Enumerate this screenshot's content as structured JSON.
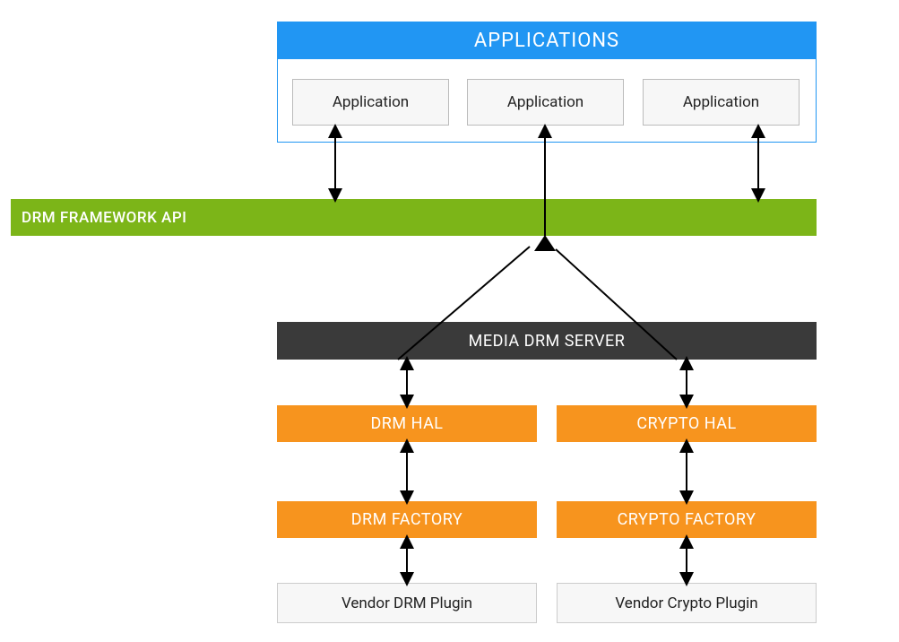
{
  "applications": {
    "header": "APPLICATIONS",
    "apps": [
      "Application",
      "Application",
      "Application"
    ]
  },
  "drmFrameworkApi": "DRM FRAMEWORK API",
  "mediaDrmServer": "MEDIA DRM SERVER",
  "drmHal": "DRM HAL",
  "cryptoHal": "CRYPTO HAL",
  "drmFactory": "DRM FACTORY",
  "cryptoFactory": "CRYPTO FACTORY",
  "vendorDrmPlugin": "Vendor DRM Plugin",
  "vendorCryptoPlugin": "Vendor Crypto Plugin",
  "colors": {
    "blue": "#2196f3",
    "green": "#7cb518",
    "orange": "#f7941e",
    "darkGray": "#3a3a3a",
    "lightGray": "#f7f7f7"
  }
}
